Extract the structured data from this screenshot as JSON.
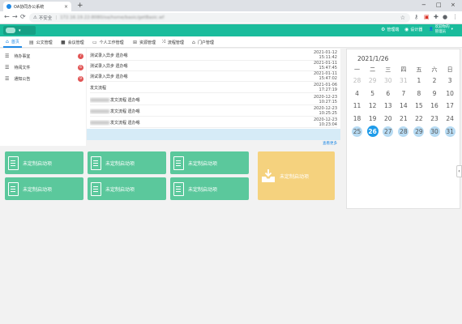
{
  "browser": {
    "tab_title": "OA协同办公系统",
    "tab_close": "×",
    "new_tab": "+",
    "security_label": "不安全",
    "url": "172.16.19.22:8080/oa/home/basic/getBasic.wf",
    "win_min": "−",
    "win_max": "□",
    "win_close": "×"
  },
  "header": {
    "logo_suffix": "▾",
    "buttons": [
      {
        "icon": "⚙",
        "label": "管理端"
      },
      {
        "icon": "◉",
        "label": "设计器"
      }
    ],
    "user_line1": "欢迎你的",
    "user_line2": "管理员"
  },
  "menu": {
    "items": [
      {
        "icon": "⌂",
        "label": "首页"
      },
      {
        "icon": "▤",
        "label": "公文管理"
      },
      {
        "icon": "■",
        "label": "会议管理"
      },
      {
        "icon": "▭",
        "label": "个人工作管理"
      },
      {
        "icon": "⊞",
        "label": "资源管理"
      },
      {
        "icon": "⤨",
        "label": "流程管理"
      },
      {
        "icon": "⌂",
        "label": "门户管理"
      }
    ]
  },
  "left_list": [
    {
      "label": "待办事宜",
      "badge": "7"
    },
    {
      "label": "待阅文件",
      "badge": "6"
    },
    {
      "label": "通知公告",
      "badge": "9"
    }
  ],
  "news": {
    "rows": [
      {
        "title": "测试录入异步 遗办嗯",
        "date": "2021-01-12 15:11:42",
        "blurred": false
      },
      {
        "title": "测试录入异步 遗办嗯",
        "date": "2021-01-11 15:47:45",
        "blurred": false
      },
      {
        "title": "测试录入异步 遗办嗯",
        "date": "2021-01-11 15:47:02",
        "blurred": false
      },
      {
        "title": "发文流程",
        "date": "2021-01-06 17:27:19",
        "blurred": false
      },
      {
        "title": "发文流程 遗办嗯",
        "date": "2020-12-23 10:27:15",
        "blurred": true
      },
      {
        "title": "发文流程 遗办嗯",
        "date": "2020-12-23 10:25:25",
        "blurred": true
      },
      {
        "title": "发文流程 遗办嗯",
        "date": "2020-12-23 10:23:04",
        "blurred": true
      }
    ],
    "more_label": "查看更多"
  },
  "calendar": {
    "month_label": "2021/1/26",
    "weekdays": [
      "一",
      "二",
      "三",
      "四",
      "五",
      "六",
      "日"
    ],
    "weeks": [
      [
        {
          "d": "28",
          "o": true
        },
        {
          "d": "29",
          "o": true
        },
        {
          "d": "30",
          "o": true
        },
        {
          "d": "31",
          "o": true
        },
        {
          "d": "1"
        },
        {
          "d": "2"
        },
        {
          "d": "3"
        }
      ],
      [
        {
          "d": "4"
        },
        {
          "d": "5"
        },
        {
          "d": "6"
        },
        {
          "d": "7"
        },
        {
          "d": "8"
        },
        {
          "d": "9"
        },
        {
          "d": "10"
        }
      ],
      [
        {
          "d": "11"
        },
        {
          "d": "12"
        },
        {
          "d": "13"
        },
        {
          "d": "14"
        },
        {
          "d": "15"
        },
        {
          "d": "16"
        },
        {
          "d": "17"
        }
      ],
      [
        {
          "d": "18"
        },
        {
          "d": "19"
        },
        {
          "d": "20"
        },
        {
          "d": "21"
        },
        {
          "d": "22"
        },
        {
          "d": "23"
        },
        {
          "d": "24"
        }
      ],
      [
        {
          "d": "25",
          "h": true
        },
        {
          "d": "26",
          "t": true
        },
        {
          "d": "27",
          "h": true
        },
        {
          "d": "28",
          "h": true
        },
        {
          "d": "29",
          "h": true
        },
        {
          "d": "30",
          "h": true
        },
        {
          "d": "31",
          "h": true
        }
      ]
    ]
  },
  "tiles": {
    "label": "未定制启动项",
    "big_label": "未定制启动项"
  },
  "side_tab": "‹",
  "colors": {
    "header": "#1abc9c",
    "tile": "#5bc89c",
    "big_tile": "#f5d27e",
    "accent": "#1e88e5",
    "badge": "#e15555"
  }
}
